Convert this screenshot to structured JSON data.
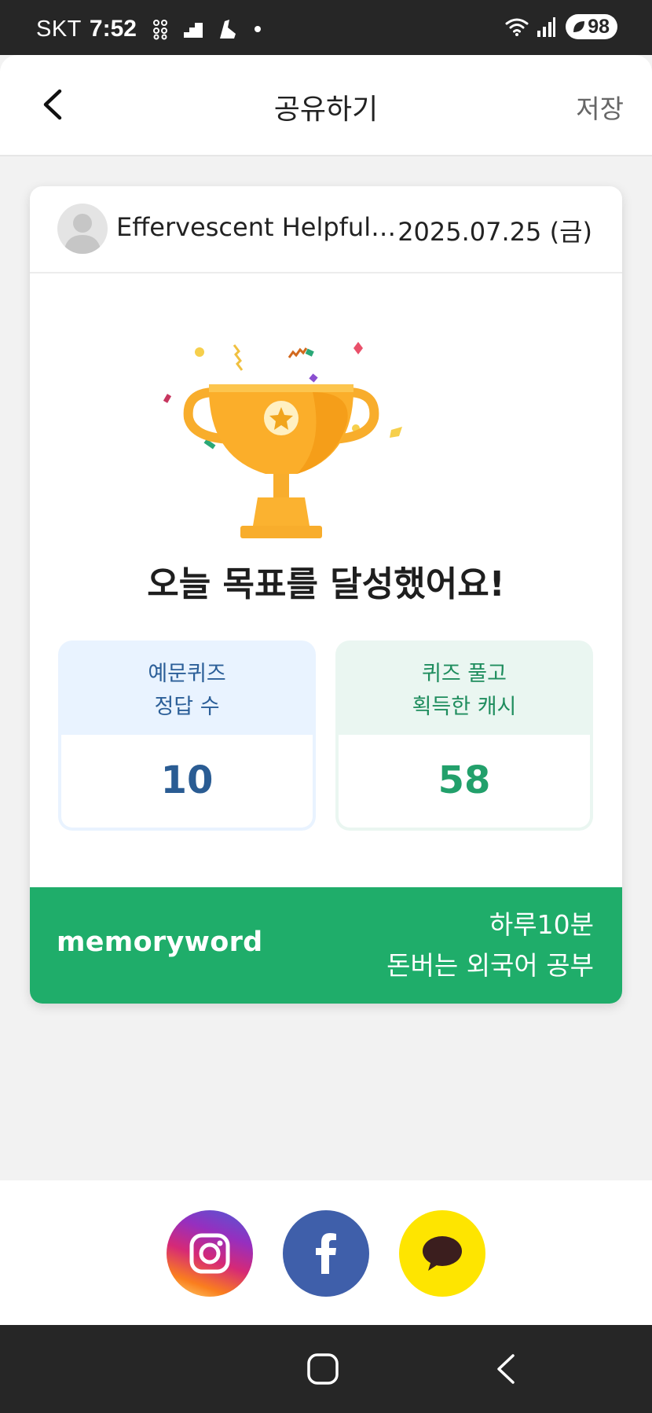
{
  "status_bar": {
    "carrier": "SKT",
    "time": "7:52",
    "battery": "98"
  },
  "header": {
    "title": "공유하기",
    "save_label": "저장"
  },
  "card": {
    "user_name": "Effervescent Helpful Mackerel",
    "date": "2025.07.25 (금)",
    "goal_message": "오늘 목표를 달성했어요!",
    "stats": [
      {
        "label": "예문퀴즈\n정답 수",
        "value": "10",
        "color": "#2a5c93"
      },
      {
        "label": "퀴즈 풀고\n획득한 캐시",
        "value": "58",
        "color": "#22a06b"
      }
    ],
    "footer": {
      "brand": "memoryword",
      "slogan_line1": "하루10분",
      "slogan_line2": "돈버는 외국어 공부",
      "background": "#1fad6a"
    }
  },
  "share": {
    "buttons": [
      {
        "name": "instagram",
        "icon": "instagram-icon"
      },
      {
        "name": "facebook",
        "icon": "facebook-icon"
      },
      {
        "name": "kakaotalk",
        "icon": "kakaotalk-icon"
      }
    ]
  },
  "nav_bar": {
    "icons": [
      "home-icon",
      "back-icon"
    ]
  }
}
